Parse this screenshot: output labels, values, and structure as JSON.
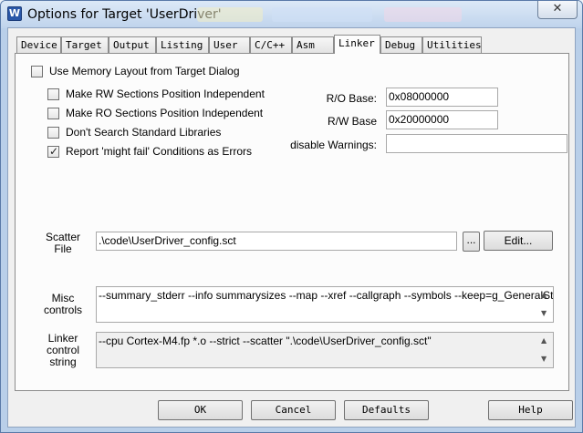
{
  "window": {
    "title": "Options for Target 'UserDriver'",
    "close_glyph": "✕",
    "app_icon_letter": "W"
  },
  "tabs": [
    {
      "label": "Device"
    },
    {
      "label": "Target"
    },
    {
      "label": "Output"
    },
    {
      "label": "Listing"
    },
    {
      "label": "User"
    },
    {
      "label": "C/C++"
    },
    {
      "label": "Asm"
    },
    {
      "label": "Linker",
      "active": true
    },
    {
      "label": "Debug"
    },
    {
      "label": "Utilities"
    }
  ],
  "options": {
    "use_memory_layout": {
      "label": "Use Memory Layout from Target Dialog",
      "checked": false
    },
    "rw_independent": {
      "label": "Make RW Sections Position Independent",
      "checked": false
    },
    "ro_independent": {
      "label": "Make RO Sections Position Independent",
      "checked": false
    },
    "no_std_libs": {
      "label": "Don't Search Standard Libraries",
      "checked": false
    },
    "might_fail_errors": {
      "label": "Report 'might fail' Conditions as Errors",
      "checked": true
    }
  },
  "check_mark": "✓",
  "ro_base": {
    "label": "R/O Base:",
    "value": "0x08000000"
  },
  "rw_base": {
    "label": "R/W Base",
    "value": "0x20000000"
  },
  "disable_warnings": {
    "label": "disable Warnings:",
    "value": ""
  },
  "scatter": {
    "label_line1": "Scatter",
    "label_line2": "File",
    "value": ".\\code\\UserDriver_config.sct",
    "browse_label": "...",
    "edit_label": "Edit..."
  },
  "misc": {
    "label_line1": "Misc",
    "label_line2": "controls",
    "value": "--summary_stderr --info summarysizes --map --xref --callgraph --symbols --keep=g_GeneralStream_UserD"
  },
  "linker_string": {
    "label_line1": "Linker",
    "label_line2": "control",
    "label_line3": "string",
    "value": "--cpu Cortex-M4.fp *.o --strict --scatter \".\\code\\UserDriver_config.sct\""
  },
  "scroll": {
    "up": "▲",
    "down": "▼"
  },
  "buttons": {
    "ok": "OK",
    "cancel": "Cancel",
    "defaults": "Defaults",
    "help": "Help"
  }
}
